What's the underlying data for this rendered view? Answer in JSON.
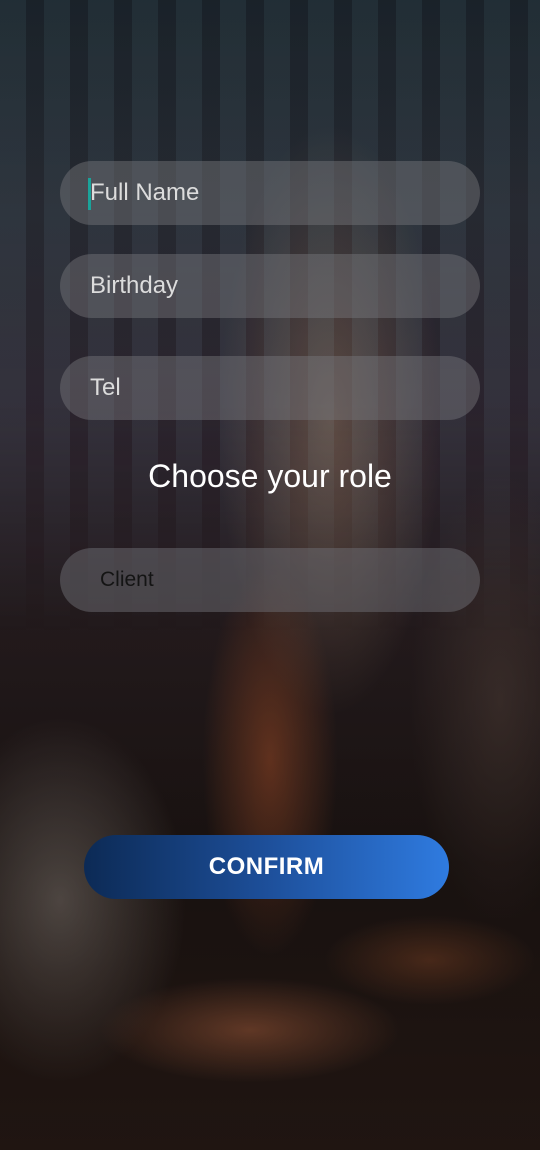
{
  "form": {
    "full_name": {
      "placeholder": "Full Name",
      "value": ""
    },
    "birthday": {
      "placeholder": "Birthday",
      "value": ""
    },
    "tel": {
      "placeholder": "Tel",
      "value": ""
    }
  },
  "role": {
    "heading": "Choose your role",
    "selected": "Client"
  },
  "actions": {
    "confirm_label": "CONFIRM"
  },
  "colors": {
    "button_gradient_start": "#0c2a55",
    "button_gradient_end": "#2f7be0",
    "cursor": "#1aa39a"
  }
}
